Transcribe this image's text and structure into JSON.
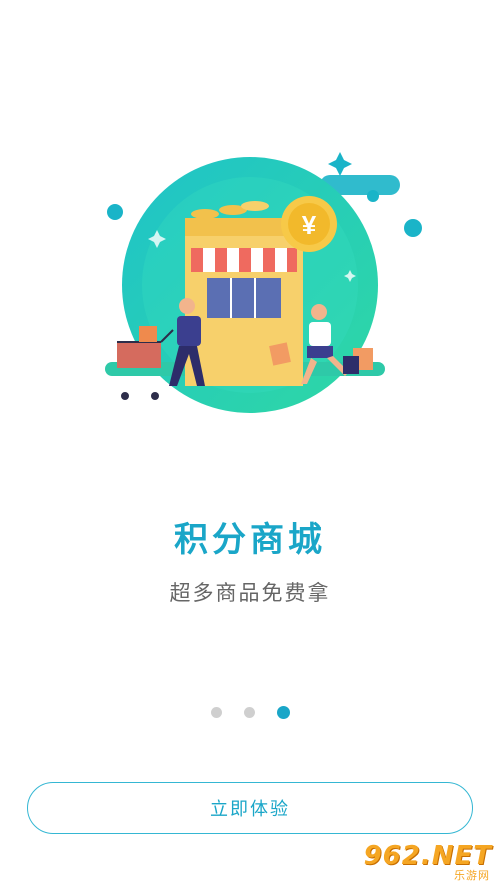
{
  "onboarding": {
    "title": "积分商城",
    "subtitle": "超多商品免费拿",
    "page_indicator": {
      "total": 3,
      "current": 3
    },
    "cta_label": "立即体验"
  },
  "illustration": {
    "price_coin_symbol": "¥"
  },
  "watermark": {
    "main": "962.NET",
    "sub": "乐游网"
  },
  "colors": {
    "accent": "#1aa6c8",
    "teal": "#2fd0b5",
    "inactive_dot": "#cfcfcf"
  }
}
